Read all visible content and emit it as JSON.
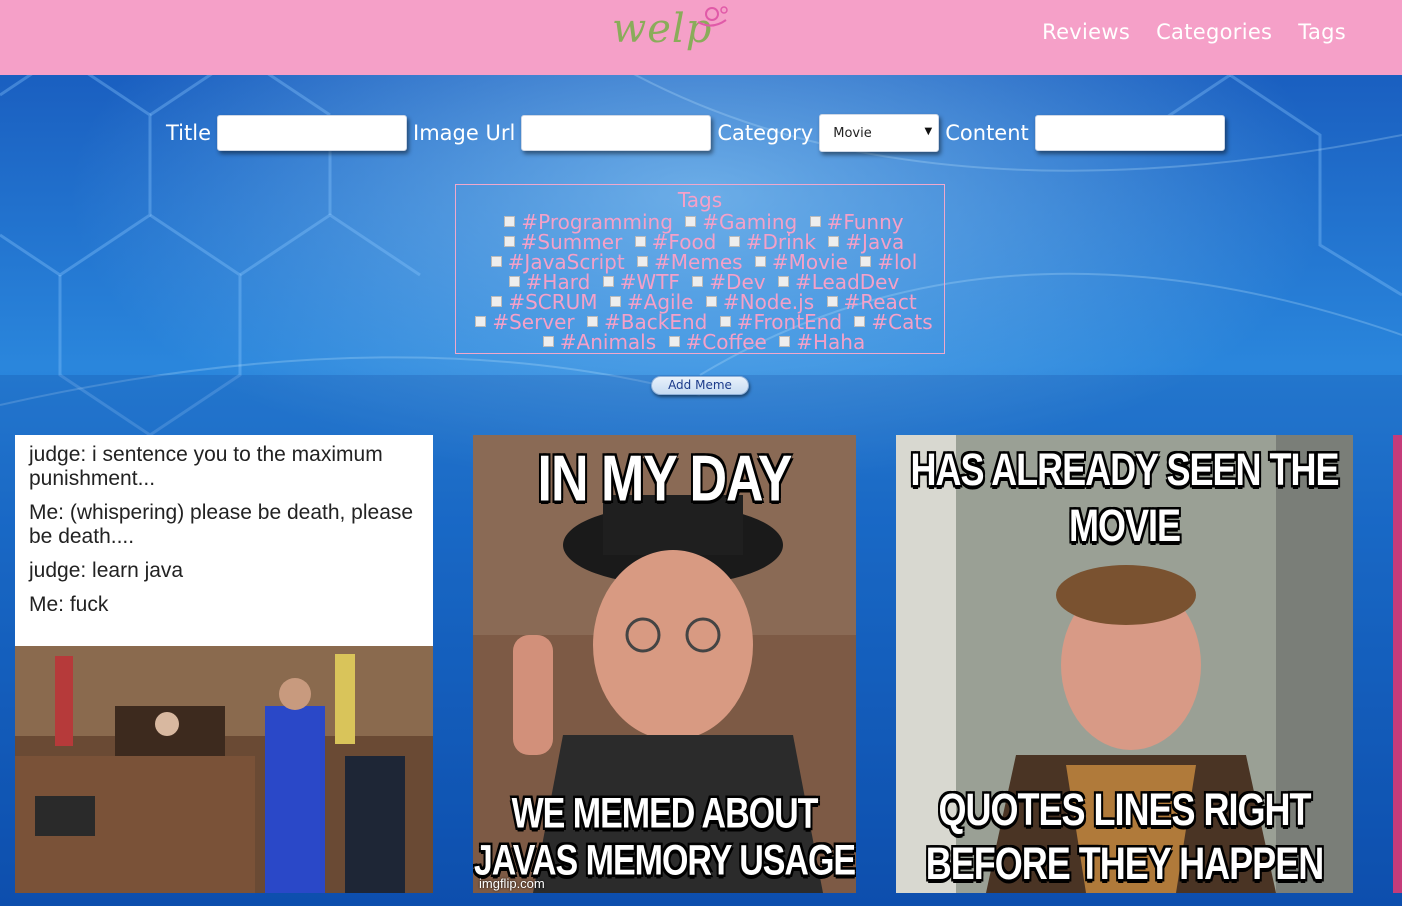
{
  "header": {
    "logo_text": "welp",
    "nav": [
      "Reviews",
      "Categories",
      "Tags"
    ]
  },
  "form": {
    "title_label": "Title",
    "image_url_label": "Image Url",
    "category_label": "Category",
    "category_value": "Movie",
    "content_label": "Content",
    "tags_legend": "Tags",
    "tags": [
      "#Programming",
      "#Gaming",
      "#Funny",
      "#Summer",
      "#Food",
      "#Drink",
      "#Java",
      "#JavaScript",
      "#Memes",
      "#Movie",
      "#lol",
      "#Hard",
      "#WTF",
      "#Dev",
      "#LeadDev",
      "#SCRUM",
      "#Agile",
      "#Node.js",
      "#React",
      "#Server",
      "#BackEnd",
      "#FrontEnd",
      "#Cats",
      "#Animals",
      "#Coffee",
      "#Haha"
    ],
    "submit_label": "Add Meme"
  },
  "memes": [
    {
      "lines": [
        "judge: i sentence you to the maximum punishment...",
        "Me: (whispering) please be death, please be death....",
        "judge: learn java",
        "Me: fuck"
      ]
    },
    {
      "top": "IN MY DAY",
      "bottom": "WE MEMED ABOUT",
      "bottom2": "JAVAS MEMORY USAGE",
      "watermark": "imgflip.com"
    },
    {
      "top": "HAS ALREADY SEEN THE",
      "top2": "MOVIE",
      "bottom": "QUOTES LINES RIGHT",
      "bottom2": "BEFORE THEY HAPPEN"
    }
  ],
  "colors": {
    "header_bg": "#f5a0c8",
    "accent_pink": "#f5a0c8",
    "logo_green": "#8aac5a",
    "page_bg": "#1769c9"
  }
}
